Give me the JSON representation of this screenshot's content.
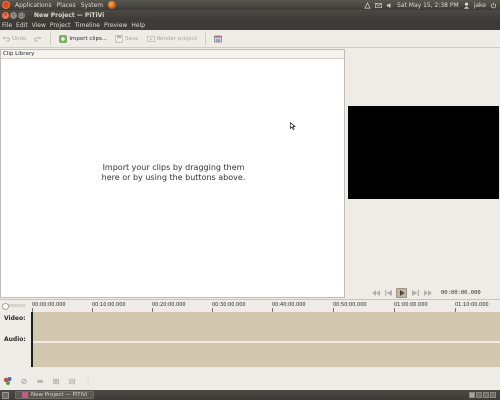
{
  "top_panel": {
    "menus": [
      "Applications",
      "Places",
      "System"
    ],
    "datetime": "Sat May 15,  2:38 PM",
    "user": "jake"
  },
  "window": {
    "title": "New Project — PiTiVi"
  },
  "menubar": [
    "File",
    "Edit",
    "View",
    "Project",
    "Timeline",
    "Preview",
    "Help"
  ],
  "toolbar": {
    "undo": "Undo",
    "redo": "",
    "import": "Import clips...",
    "save": "Save",
    "render": "Render project"
  },
  "clip_library": {
    "tab_label": "Clip Library",
    "empty_message": "Import your clips by dragging them here or by using the buttons above."
  },
  "viewer": {
    "time": "00:00:00.000"
  },
  "timeline": {
    "ruler_ticks": [
      "00:00:00.000",
      "00:10:00.000",
      "00:20:00.000",
      "00:30:00.000",
      "00:40:00.000",
      "00:50:00.000",
      "01:00:00.000",
      "01:10:00.000"
    ],
    "tracks": [
      "Video:",
      "Audio:"
    ]
  },
  "taskbar": {
    "task_label": "New Project — PiTiVi"
  },
  "colors": {
    "panel": "#3c3b37",
    "track_bg": "#d4c7b0",
    "viewer_bg": "#000000",
    "accent": "#f07746"
  }
}
